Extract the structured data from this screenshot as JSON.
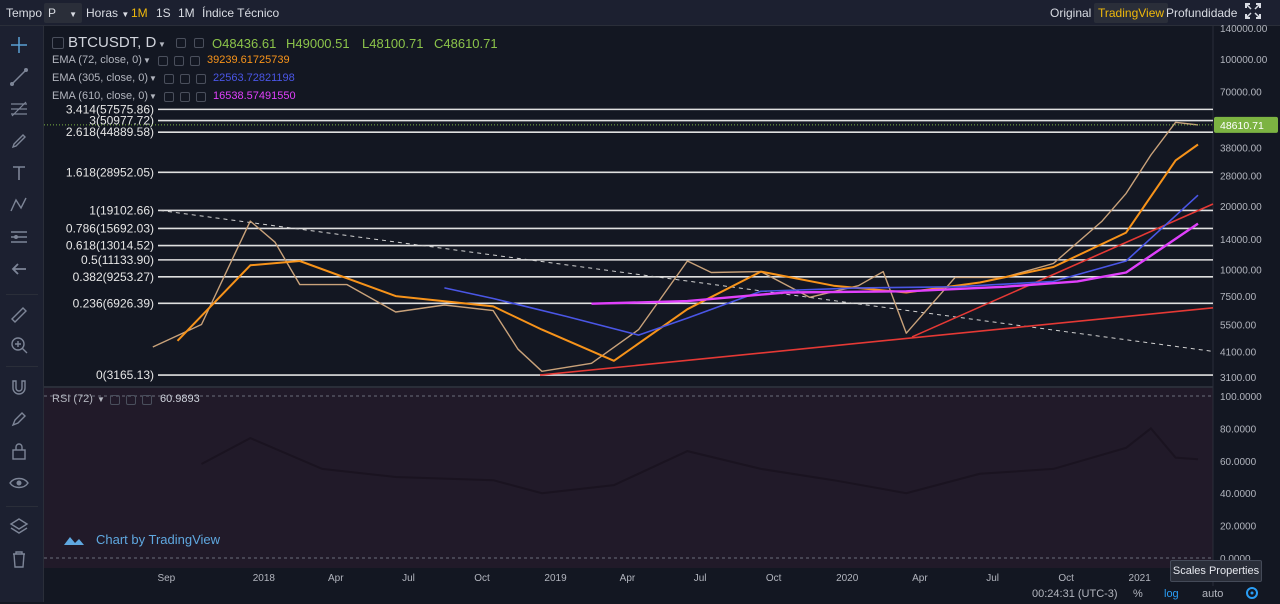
{
  "toolbar": {
    "tempo_label": "Tempo",
    "period_value": "P",
    "interval_value": "Horas",
    "range_buttons": [
      "1M",
      "1S",
      "1M"
    ],
    "indicators_label": "Índice Técnico",
    "view_tabs": [
      "Original",
      "TradingView",
      "Profundidade"
    ],
    "active_view": "TradingView"
  },
  "legend": {
    "symbol": "BTCUSDT, D",
    "open": "O48436.61",
    "high": "H49000.51",
    "low": "L48100.71",
    "close": "C48610.71",
    "indicators": [
      {
        "label": "EMA (72, close, 0)",
        "value": "39239.61725739",
        "color": "#f7931a"
      },
      {
        "label": "EMA (305, close, 0)",
        "value": "22563.72821198",
        "color": "#4a56e6"
      },
      {
        "label": "EMA (610, close, 0)",
        "value": "16538.57491550",
        "color": "#e040fb"
      }
    ],
    "rsi_label": "RSI (72)",
    "rsi_value": "60.9893"
  },
  "colors": {
    "background": "#131722",
    "fib": "#e0e0e0",
    "ema72": "#f7931a",
    "ema305": "#4a56e6",
    "ema610": "#e040fb",
    "trend": "#e53935",
    "rsi_bg": "#2a1f33",
    "price_badge": "#7cb342"
  },
  "chart_data": [
    {
      "type": "line",
      "title": "",
      "scale": "log",
      "price_axis_ticks": [
        "140000.00",
        "100000.00",
        "70000.00",
        "50000.00",
        "38000.00",
        "28000.00",
        "20000.00",
        "14000.00",
        "10000.00",
        "7500.00",
        "5500.00",
        "4100.00",
        "3100.00"
      ],
      "time_axis_ticks": [
        "Sep",
        "2018",
        "Apr",
        "Jul",
        "Oct",
        "2019",
        "Apr",
        "Jul",
        "Oct",
        "2020",
        "Apr",
        "Jul",
        "Oct",
        "2021"
      ],
      "last_price": "48610.71",
      "fib_levels": [
        {
          "label": "3.414(57575.86)",
          "value": 57575.86
        },
        {
          "label": "3(50977.72)",
          "value": 50977.72
        },
        {
          "label": "2.618(44889.58)",
          "value": 44889.58
        },
        {
          "label": "1.618(28952.05)",
          "value": 28952.05
        },
        {
          "label": "1(19102.66)",
          "value": 19102.66
        },
        {
          "label": "0.786(15692.03)",
          "value": 15692.03
        },
        {
          "label": "0.618(13014.52)",
          "value": 13014.52
        },
        {
          "label": "0.5(11133.90)",
          "value": 11133.9
        },
        {
          "label": "0.382(9253.27)",
          "value": 9253.27
        },
        {
          "label": "0.236(6926.39)",
          "value": 6926.39
        },
        {
          "label": "0(3165.13)",
          "value": 3165.13
        }
      ],
      "series": [
        {
          "name": "BTCUSDT, D",
          "x": [
            "2017-08",
            "2017-10",
            "2017-12",
            "2018-01",
            "2018-02",
            "2018-04",
            "2018-06",
            "2018-08",
            "2018-10",
            "2018-11",
            "2018-12",
            "2019-02",
            "2019-04",
            "2019-06",
            "2019-07",
            "2019-09",
            "2019-11",
            "2020-01",
            "2020-02",
            "2020-03",
            "2020-05",
            "2020-07",
            "2020-09",
            "2020-11",
            "2020-12",
            "2021-01",
            "2021-02",
            "2021-03"
          ],
          "values": [
            4300,
            5500,
            17000,
            13500,
            8500,
            8500,
            6300,
            6800,
            6400,
            4200,
            3300,
            3600,
            5200,
            11000,
            9700,
            9800,
            7400,
            8400,
            9800,
            5000,
            9200,
            9200,
            10700,
            17000,
            23000,
            35000,
            50000,
            48610
          ]
        },
        {
          "name": "EMA (72, close, 0)",
          "x": [
            "2017-09",
            "2017-12",
            "2018-02",
            "2018-06",
            "2018-10",
            "2018-12",
            "2019-03",
            "2019-06",
            "2019-09",
            "2019-12",
            "2020-03",
            "2020-06",
            "2020-09",
            "2020-12",
            "2021-02",
            "2021-03"
          ],
          "values": [
            4600,
            10500,
            11000,
            7500,
            6700,
            5200,
            3700,
            6500,
            9800,
            8400,
            7800,
            8700,
            10300,
            15000,
            33000,
            39239
          ]
        },
        {
          "name": "EMA (305, close, 0)",
          "x": [
            "2018-08",
            "2018-10",
            "2019-01",
            "2019-04",
            "2019-06",
            "2019-09",
            "2020-01",
            "2020-05",
            "2020-09",
            "2020-12",
            "2021-03"
          ],
          "values": [
            8200,
            7300,
            6000,
            4900,
            5900,
            7900,
            8200,
            8300,
            8800,
            11000,
            22563
          ]
        },
        {
          "name": "EMA (610, close, 0)",
          "x": [
            "2019-02",
            "2019-06",
            "2019-10",
            "2020-03",
            "2020-07",
            "2020-10",
            "2020-12",
            "2021-03"
          ],
          "values": [
            6900,
            7100,
            7800,
            7900,
            8300,
            8800,
            9700,
            16538
          ]
        }
      ]
    },
    {
      "type": "line",
      "title": "",
      "ylabel": "",
      "y_axis_ticks": [
        "100.0000",
        "80.0000",
        "60.0000",
        "40.0000",
        "20.0000",
        "0.0000"
      ],
      "series": [
        {
          "name": "RSI (72)",
          "x": [
            "2017-10",
            "2017-12",
            "2018-03",
            "2018-06",
            "2018-10",
            "2018-12",
            "2019-03",
            "2019-06",
            "2019-09",
            "2019-12",
            "2020-03",
            "2020-06",
            "2020-09",
            "2020-12",
            "2021-01",
            "2021-02",
            "2021-03"
          ],
          "values": [
            58,
            74,
            55,
            50,
            48,
            40,
            45,
            66,
            55,
            48,
            40,
            52,
            55,
            68,
            80,
            62,
            60.99
          ]
        }
      ]
    }
  ],
  "credit": "Chart by TradingView",
  "bottom": {
    "time": "00:24:31 (UTC-3)",
    "percent": "%",
    "log": "log",
    "auto": "auto",
    "scales_tooltip": "Scales Properties"
  }
}
